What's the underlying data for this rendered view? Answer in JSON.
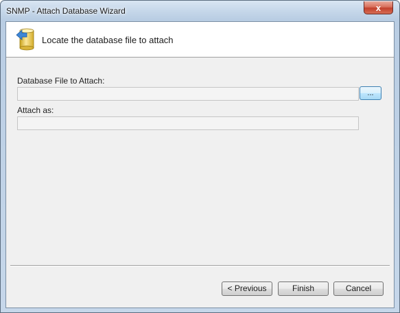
{
  "window": {
    "title": "SNMP - Attach Database Wizard",
    "close_glyph": "x"
  },
  "header": {
    "icon": "database-attach-icon",
    "text": "Locate the database file to attach"
  },
  "form": {
    "file_label": "Database File to Attach:",
    "file_value": "",
    "browse_label": "...",
    "attach_as_label": "Attach as:",
    "attach_as_value": ""
  },
  "buttons": {
    "previous": "< Previous",
    "finish": "Finish",
    "cancel": "Cancel"
  },
  "colors": {
    "titlebar": "#c6d7ea",
    "client_bg": "#f0f0f0",
    "header_bg": "#ffffff",
    "browse_accent": "#3c7fb1",
    "close_red": "#c2402c"
  }
}
